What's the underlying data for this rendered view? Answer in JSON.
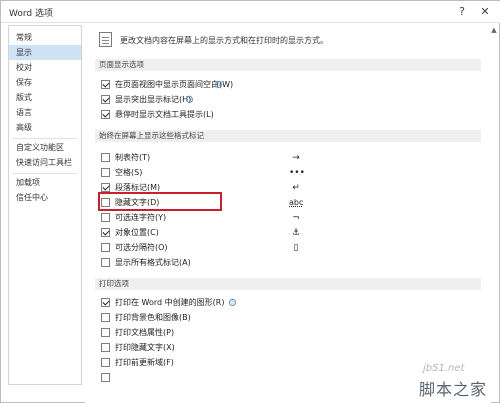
{
  "window": {
    "title": "Word 选项",
    "help_glyph": "?",
    "close_glyph": "✕",
    "scroll_glyph": "▲"
  },
  "sidebar": {
    "items": [
      {
        "label": "常规",
        "active": false
      },
      {
        "label": "显示",
        "active": true
      },
      {
        "label": "校对",
        "active": false
      },
      {
        "label": "保存",
        "active": false
      },
      {
        "label": "版式",
        "active": false
      },
      {
        "label": "语言",
        "active": false
      },
      {
        "label": "高级",
        "active": false
      },
      {
        "label": "自定义功能区",
        "active": false
      },
      {
        "label": "快速访问工具栏",
        "active": false
      },
      {
        "label": "加载项",
        "active": false
      },
      {
        "label": "信任中心",
        "active": false
      }
    ]
  },
  "main": {
    "header_text": "更改文档内容在屏幕上的显示方式和在打印时的显示方式。",
    "sections": {
      "page_display": "页面显示选项",
      "formatting_marks": "始终在屏幕上显示这些格式标记",
      "print": "打印选项"
    },
    "page_display_options": [
      {
        "label": "在页面视图中显示页面间空白(W)",
        "checked": true,
        "info": "ⓘ"
      },
      {
        "label": "显示突出显示标记(H)",
        "checked": true,
        "info": "ⓘ"
      },
      {
        "label": "悬停时显示文档工具提示(L)",
        "checked": true
      }
    ],
    "formatting_options": [
      {
        "label": "制表符(T)",
        "checked": false,
        "symbol": "→"
      },
      {
        "label": "空格(S)",
        "checked": false,
        "symbol": "•••"
      },
      {
        "label": "段落标记(M)",
        "checked": true,
        "symbol": "↵"
      },
      {
        "label": "隐藏文字(D)",
        "checked": false,
        "symbol": "abc"
      },
      {
        "label": "可选连字符(Y)",
        "checked": false,
        "symbol": "¬"
      },
      {
        "label": "对象位置(C)",
        "checked": true,
        "symbol": "⚓"
      },
      {
        "label": "可选分隔符(O)",
        "checked": false,
        "symbol": "▯"
      },
      {
        "label": "显示所有格式标记(A)",
        "checked": false
      }
    ],
    "print_options": [
      {
        "label": "打印在 Word 中创建的图形(R)",
        "checked": true,
        "info": "ⓘ"
      },
      {
        "label": "打印背景色和图像(B)",
        "checked": false
      },
      {
        "label": "打印文档属性(P)",
        "checked": false
      },
      {
        "label": "打印隐藏文字(X)",
        "checked": false
      },
      {
        "label": "打印前更新域(F)",
        "checked": false
      }
    ]
  },
  "watermark": {
    "url": "jb51.net",
    "brand": "脚本之家"
  }
}
